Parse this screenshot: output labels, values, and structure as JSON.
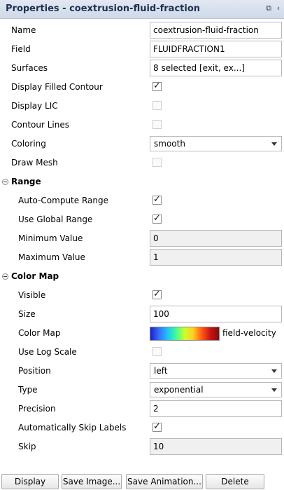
{
  "title": "Properties - coextrusion-fluid-fraction",
  "title_icons": [
    "float-icon",
    "close-icon"
  ],
  "fields": {
    "name": {
      "label": "Name",
      "value": "coextrusion-fluid-fraction"
    },
    "field": {
      "label": "Field",
      "value": "FLUIDFRACTION1"
    },
    "surfaces": {
      "label": "Surfaces",
      "value": "8 selected [exit, ex...]"
    },
    "display_filled_contour": {
      "label": "Display Filled Contour",
      "checked": true
    },
    "display_lic": {
      "label": "Display LIC",
      "checked": false
    },
    "contour_lines": {
      "label": "Contour Lines",
      "checked": false
    },
    "coloring": {
      "label": "Coloring",
      "value": "smooth"
    },
    "draw_mesh": {
      "label": "Draw Mesh",
      "checked": false
    }
  },
  "range": {
    "header": "Range",
    "auto_compute": {
      "label": "Auto-Compute Range",
      "checked": true
    },
    "use_global": {
      "label": "Use Global Range",
      "checked": true
    },
    "min": {
      "label": "Minimum Value",
      "value": "0"
    },
    "max": {
      "label": "Maximum Value",
      "value": "1"
    }
  },
  "color_map": {
    "header": "Color Map",
    "visible": {
      "label": "Visible",
      "checked": true
    },
    "size": {
      "label": "Size",
      "value": "100"
    },
    "map": {
      "label": "Color Map",
      "value": "field-velocity"
    },
    "log_scale": {
      "label": "Use Log Scale",
      "checked": false
    },
    "position": {
      "label": "Position",
      "value": "left"
    },
    "type": {
      "label": "Type",
      "value": "exponential"
    },
    "precision": {
      "label": "Precision",
      "value": "2"
    },
    "skip_labels": {
      "label": "Automatically Skip Labels",
      "checked": true
    },
    "skip": {
      "label": "Skip",
      "value": "10"
    }
  },
  "buttons": {
    "display": "Display",
    "save_image": "Save Image...",
    "save_animation": "Save Animation...",
    "delete": "Delete"
  },
  "colors": {
    "titlebar": "#d8e0ed",
    "title_text": "#1e3150"
  }
}
